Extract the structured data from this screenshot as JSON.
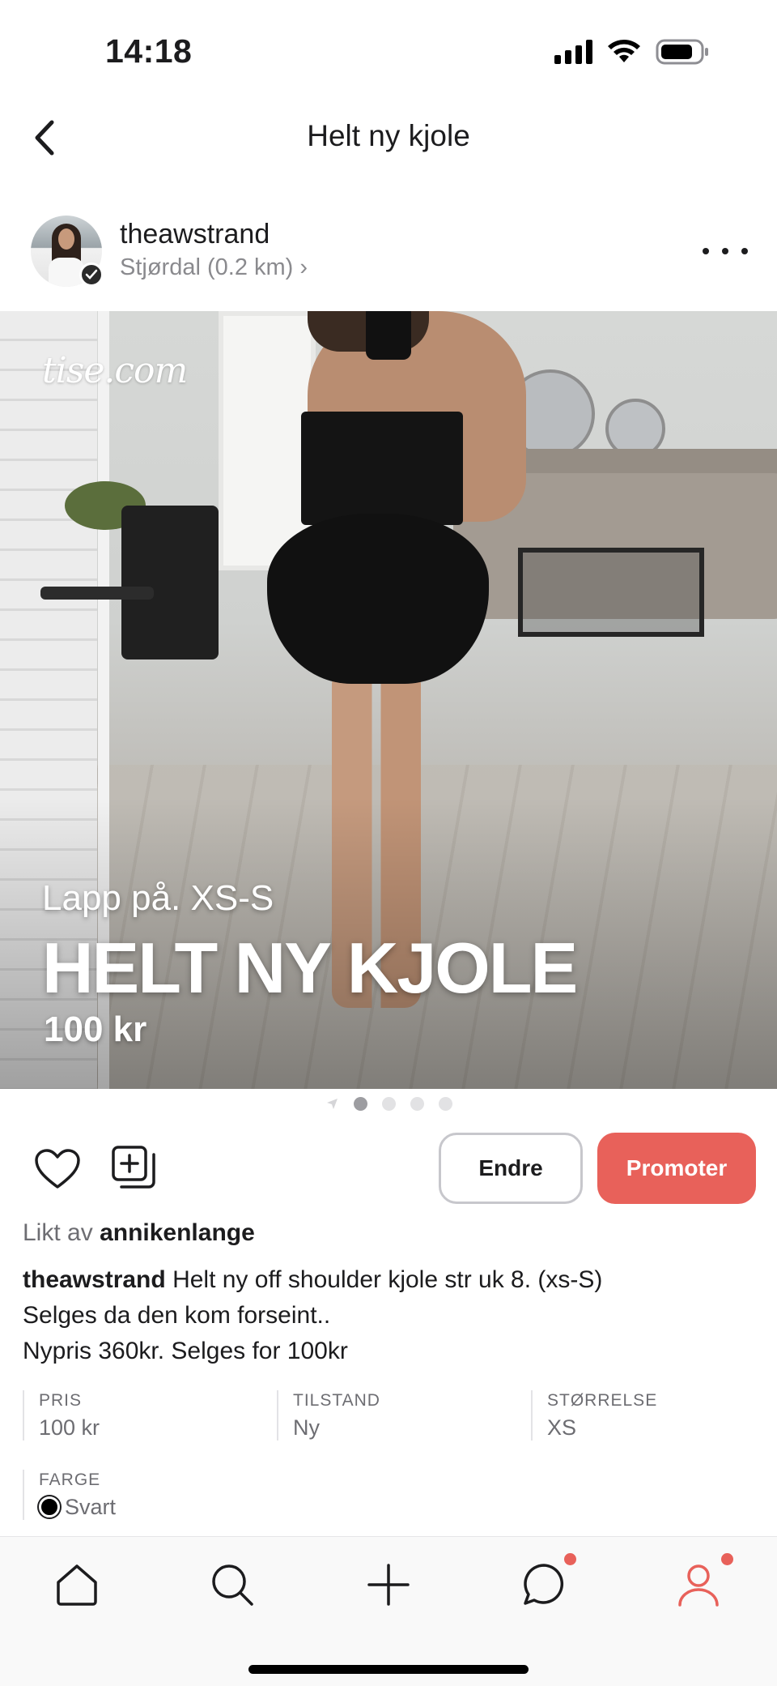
{
  "status_bar": {
    "time": "14:18"
  },
  "nav": {
    "title": "Helt ny kjole",
    "back_icon": "chevron-left-icon"
  },
  "seller": {
    "username": "theawstrand",
    "location": "Stjørdal (0.2 km)",
    "location_chevron": "›"
  },
  "photo": {
    "watermark": "tise.com",
    "overlay_subtitle": "Lapp på. XS-S",
    "overlay_title": "HELT NY KJOLE",
    "overlay_price": "100 kr",
    "pager": {
      "total": 4,
      "active_index": 0
    }
  },
  "actions": {
    "edit_label": "Endre",
    "promote_label": "Promoter",
    "promote_color": "#e8615a"
  },
  "liked_by": {
    "prefix": "Likt av",
    "user": "annikenlange"
  },
  "description": {
    "author": "theawstrand",
    "line1": "Helt ny off shoulder kjole str uk 8. (xs-S)",
    "line2": "Selges da den kom forseint..",
    "line3": "Nypris 360kr. Selges for 100kr"
  },
  "attributes": {
    "price": {
      "label": "PRIS",
      "value": "100 kr"
    },
    "condition": {
      "label": "TILSTAND",
      "value": "Ny"
    },
    "size": {
      "label": "STØRRELSE",
      "value": "XS"
    },
    "color": {
      "label": "FARGE",
      "value": "Svart",
      "swatch": "#000000"
    }
  },
  "tab_bar": {
    "items": [
      "home-icon",
      "search-icon",
      "plus-icon",
      "chat-icon",
      "profile-icon"
    ],
    "active": "profile-icon",
    "badge_color": "#e8615a"
  }
}
